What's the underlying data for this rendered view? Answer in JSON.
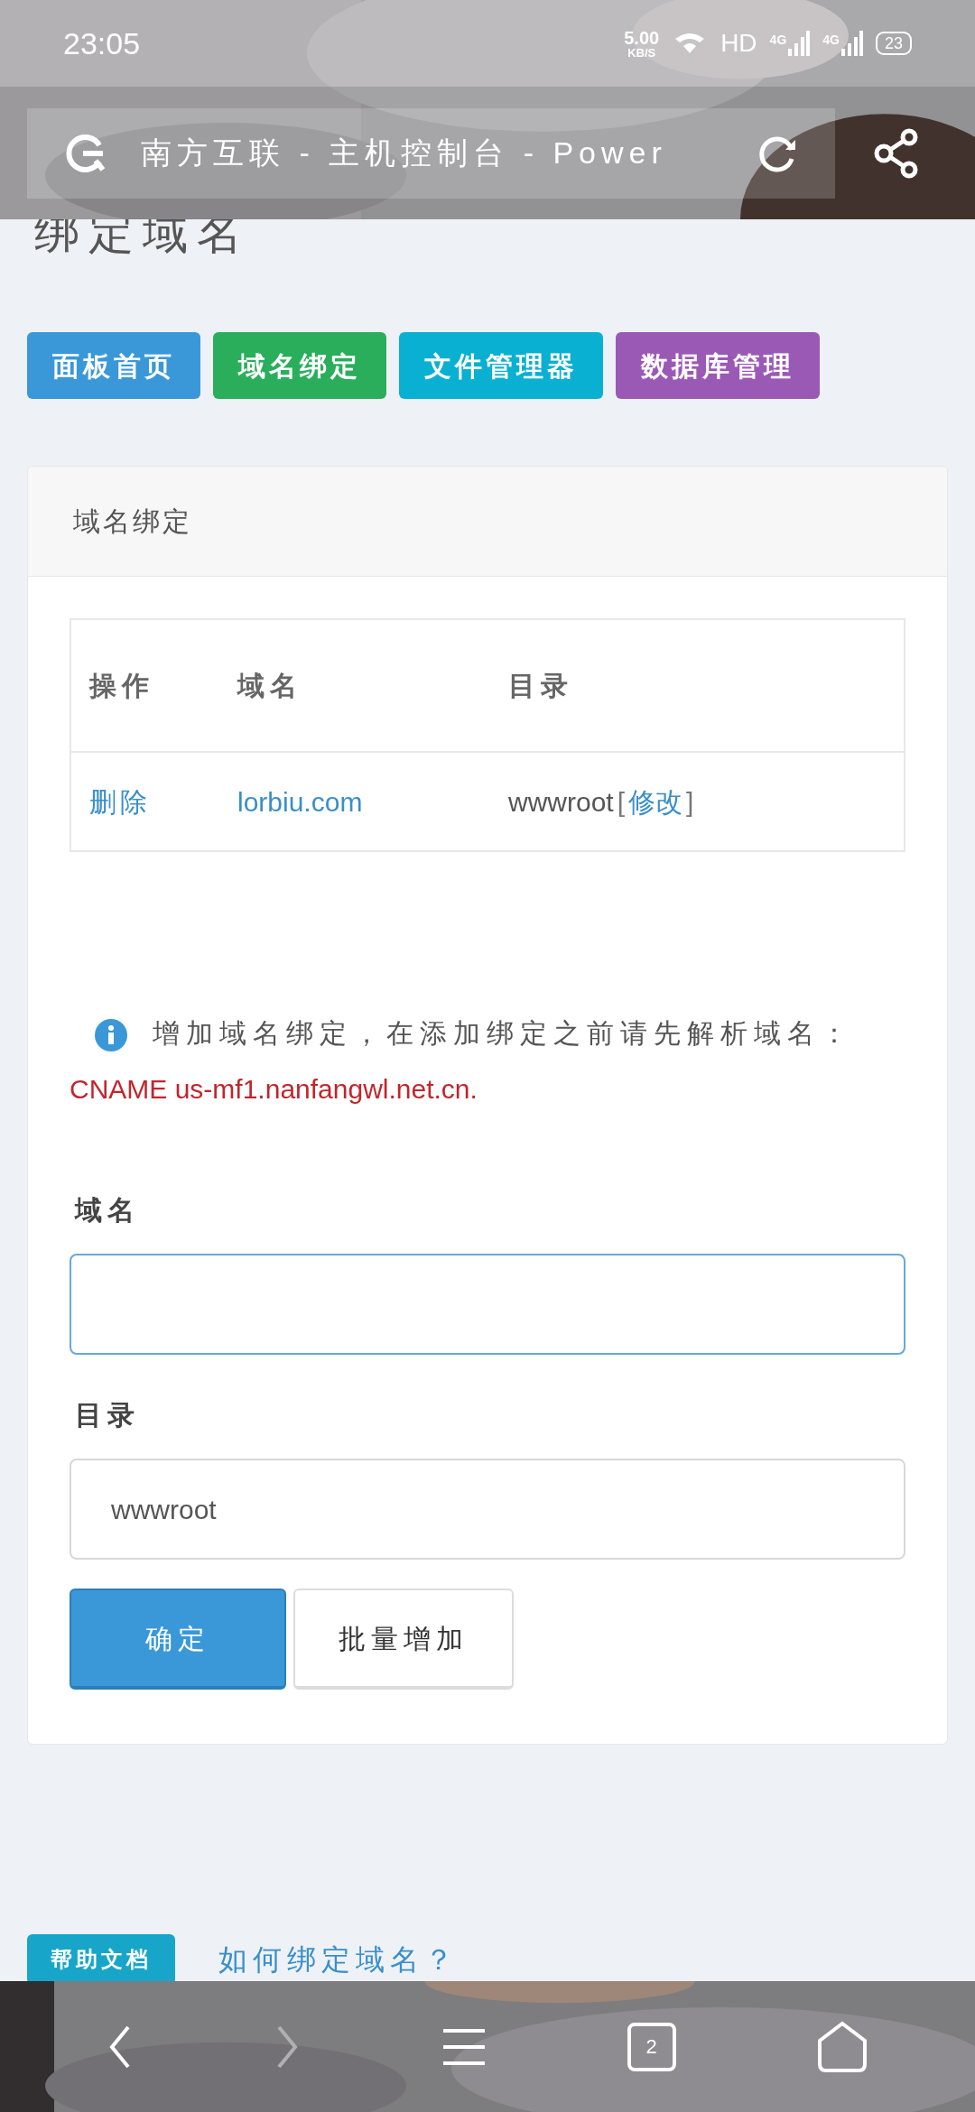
{
  "status_bar": {
    "time": "23:05",
    "speed": "5.00",
    "speed_unit": "KB/S",
    "hd": "HD",
    "signals": [
      "4G",
      "4G"
    ],
    "battery": "23"
  },
  "browser": {
    "title": "南方互联 - 主机控制台 - Power"
  },
  "page_title": "绑定域名",
  "nav_buttons": [
    {
      "label": "面板首页",
      "color": "#3a98d8"
    },
    {
      "label": "域名绑定",
      "color": "#2aae5c"
    },
    {
      "label": "文件管理器",
      "color": "#0ab0d2"
    },
    {
      "label": "数据库管理",
      "color": "#9b59b6"
    }
  ],
  "card": {
    "title": "域名绑定",
    "table": {
      "columns": [
        "操作",
        "域名",
        "目录"
      ],
      "rows": [
        {
          "action": "删除",
          "domain": "lorbiu.com",
          "directory": "wwwroot",
          "bracket_open": "[",
          "edit": "修改",
          "bracket_close": "]"
        }
      ]
    },
    "notice": {
      "text": "增加域名绑定，在添加绑定之前请先解析域名：",
      "highlight": "CNAME us-mf1.nanfangwl.net.cn."
    },
    "fields": [
      {
        "label": "域名",
        "focused": true
      },
      {
        "label": "目录",
        "value": "wwwroot",
        "focused": false
      }
    ],
    "buttons": [
      {
        "label": "确定",
        "kind": "primary"
      },
      {
        "label": "批量增加",
        "kind": "default"
      }
    ]
  },
  "help": {
    "badge": "帮助文档",
    "link": "如何绑定域名？"
  },
  "bottom_nav": {
    "tab_count": "2",
    "forward_disabled": true
  }
}
